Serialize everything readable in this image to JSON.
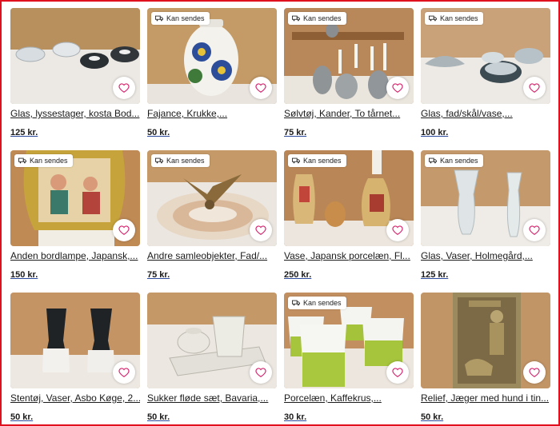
{
  "badge_label": "Kan sendes",
  "icons": {
    "badge": "truck-icon",
    "favorite": "heart-outline-icon"
  },
  "colors": {
    "accent": "#e0101f",
    "text": "#1b1b1b"
  },
  "listings": [
    {
      "title": "Glas, lyssestager, kosta Bod...",
      "price": "125 kr.",
      "badge": false
    },
    {
      "title": "Fajance, Krukke,...",
      "price": "50 kr.",
      "badge": true
    },
    {
      "title": "Sølvtøj, Kander, To tårnet...",
      "price": "75 kr.",
      "badge": true
    },
    {
      "title": "Glas, fad/skål/vase,...",
      "price": "100 kr.",
      "badge": true
    },
    {
      "title": "Anden bordlampe, Japansk,...",
      "price": "150 kr.",
      "badge": true
    },
    {
      "title": "Andre samleobjekter, Fad/...",
      "price": "75 kr.",
      "badge": true
    },
    {
      "title": "Vase, Japansk porcelæn, Fl...",
      "price": "250 kr.",
      "badge": true
    },
    {
      "title": "Glas, Vaser, Holmegård,...",
      "price": "125 kr.",
      "badge": true
    },
    {
      "title": "Stentøj, Vaser, Asbo Køge, 2...",
      "price": "50 kr.",
      "badge": false
    },
    {
      "title": "Sukker fløde sæt, Bavaria,...",
      "price": "50 kr.",
      "badge": false
    },
    {
      "title": "Porcelæn, Kaffekrus,...",
      "price": "30 kr.",
      "badge": true
    },
    {
      "title": "Relief, Jæger med hund i tin...",
      "price": "50 kr.",
      "badge": false
    }
  ]
}
